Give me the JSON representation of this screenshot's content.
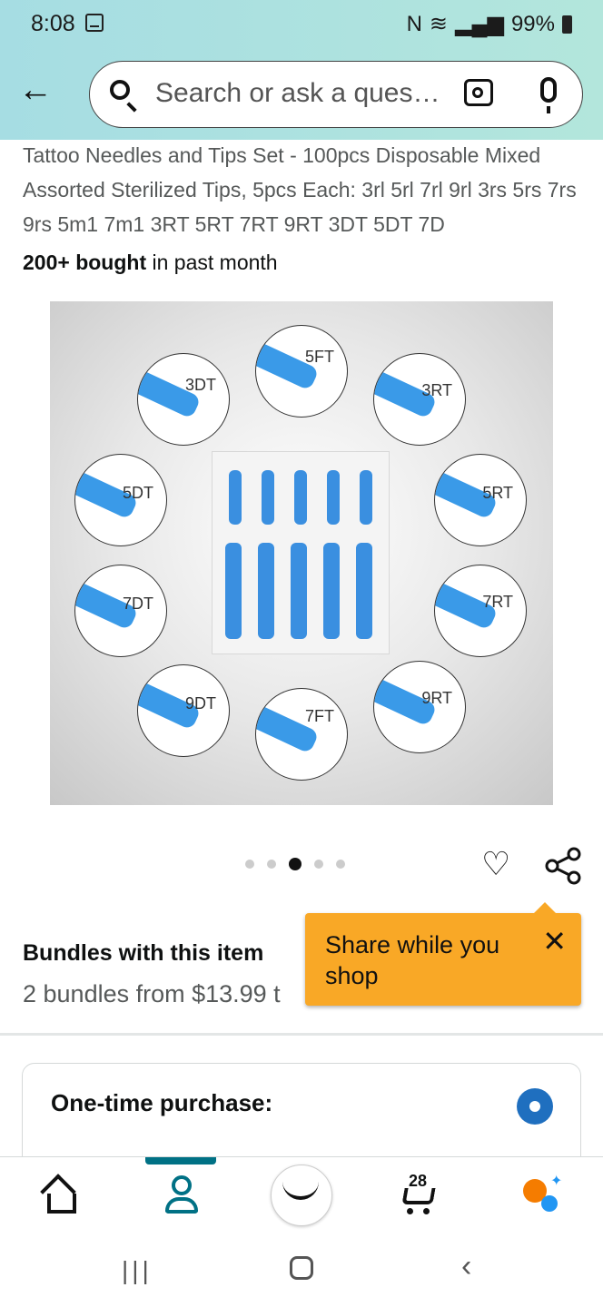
{
  "status": {
    "time": "8:08",
    "battery": "99%"
  },
  "search": {
    "placeholder": "Search or ask a ques…"
  },
  "product": {
    "title": "Tattoo Needles and Tips Set - 100pcs Disposable Mixed Assorted Sterilized Tips, 5pcs Each: 3rl 5rl 7rl 9rl 3rs 5rs 7rs 9rs 5m1 7m1 3RT 5RT 7RT 9RT 3DT 5DT 7D",
    "bought_bold": "200+ bought",
    "bought_rest": " in past month",
    "image_labels": [
      "3DT",
      "5FT",
      "3RT",
      "5DT",
      "5RT",
      "7DT",
      "7RT",
      "9DT",
      "7FT",
      "9RT"
    ]
  },
  "carousel": {
    "total": 5,
    "active_index": 2
  },
  "bundles": {
    "title": "Bundles with this item",
    "subtitle": "2 bundles from $13.99 t"
  },
  "tooltip": {
    "text": "Share while you shop",
    "close": "✕"
  },
  "purchase": {
    "title": "One-time purchase:"
  },
  "nav": {
    "cart_count": "28"
  },
  "colors": {
    "accent": "#007185",
    "tooltip": "#f9a826",
    "radio": "#1f6fbf"
  }
}
